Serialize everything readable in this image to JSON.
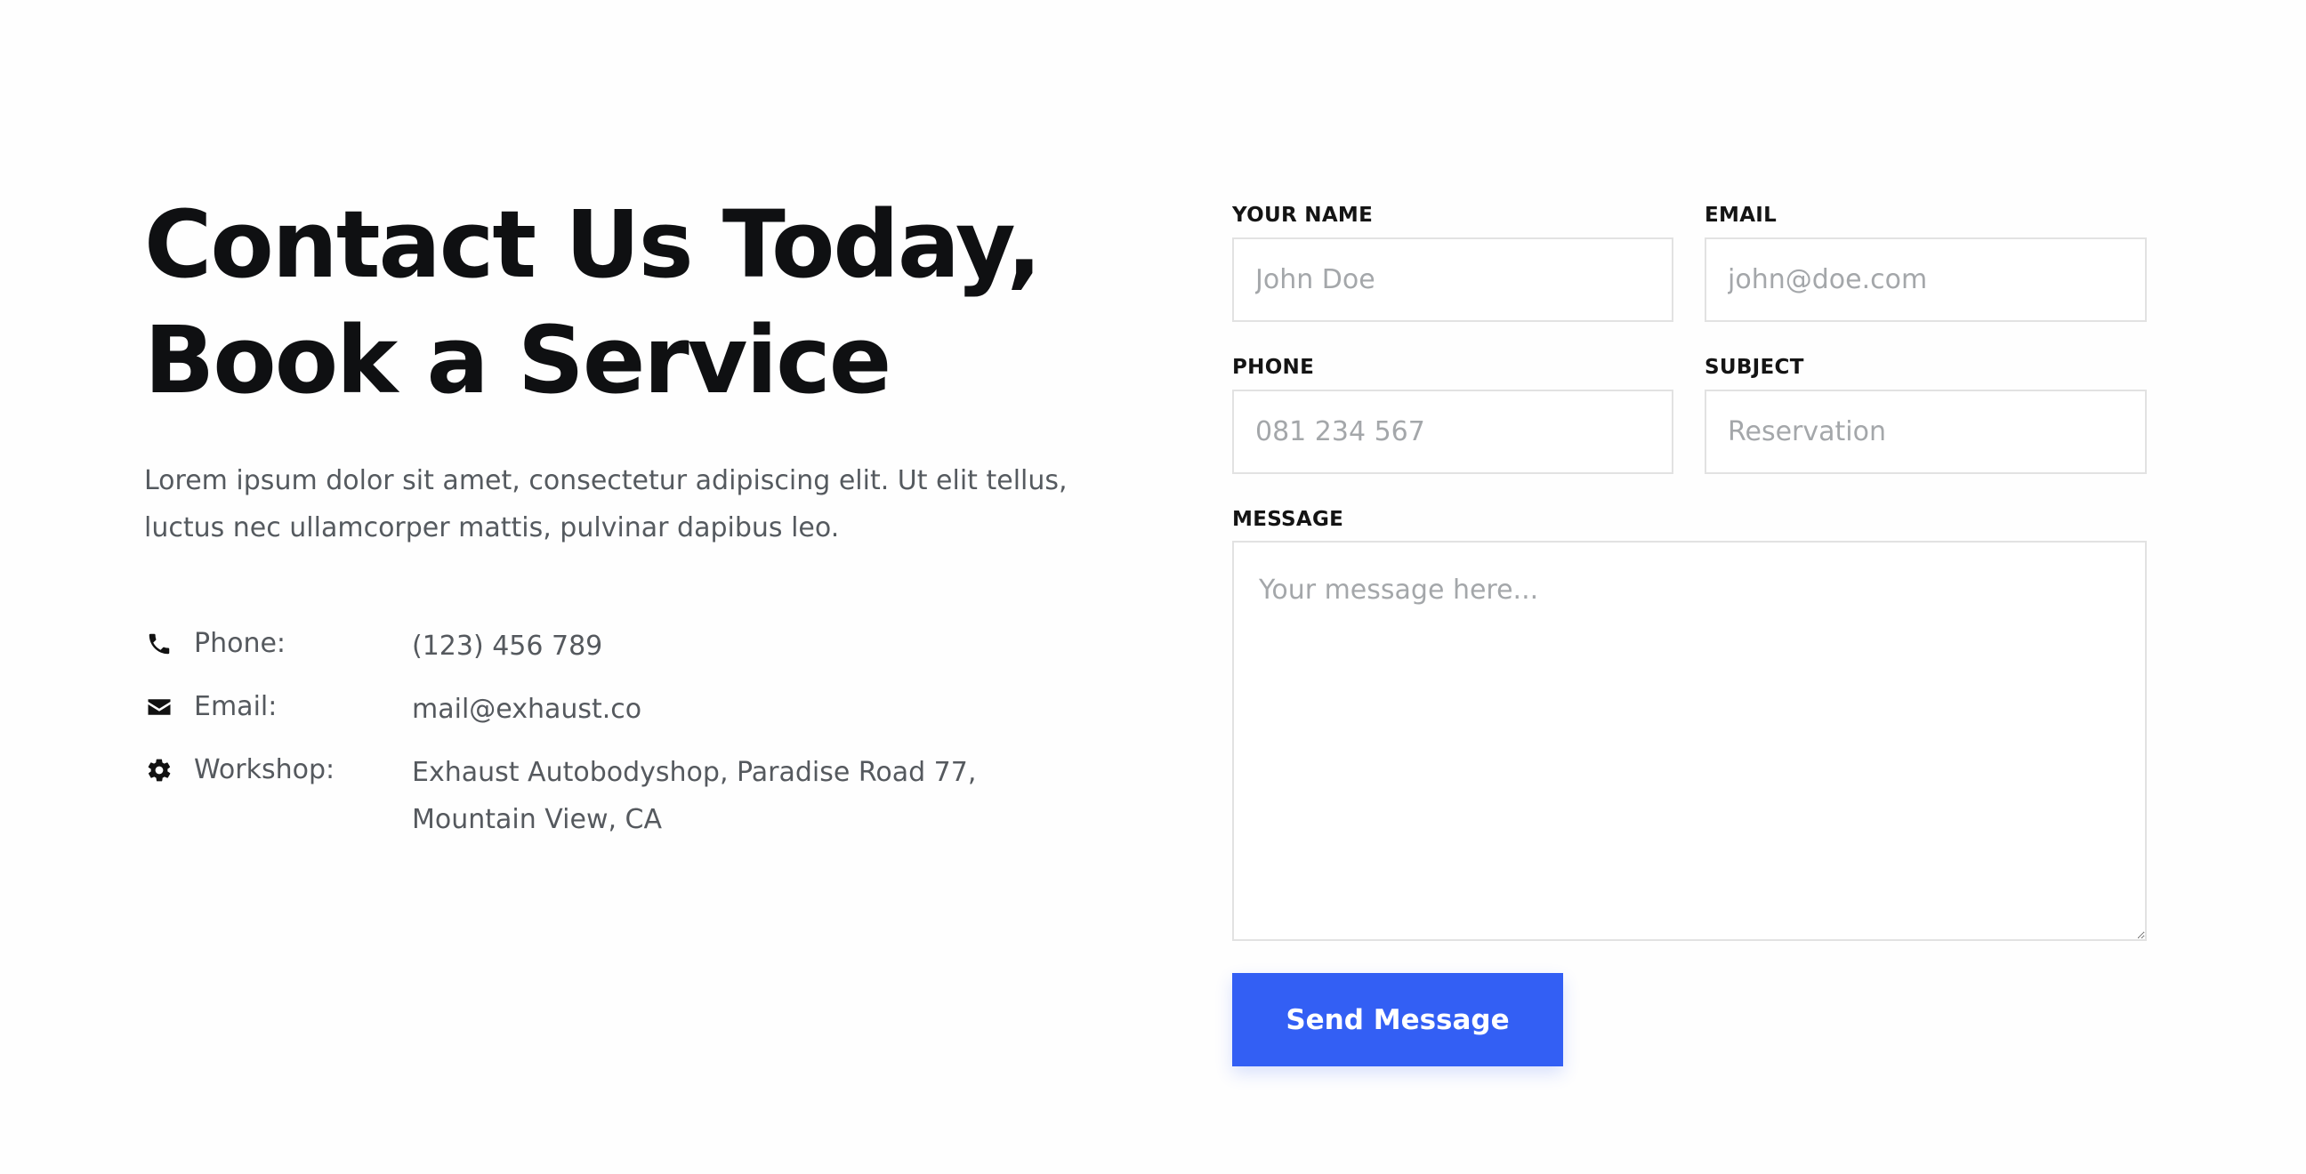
{
  "contact": {
    "headline_line1": "Contact Us Today,",
    "headline_line2": "Book a Service",
    "intro_line1": "Lorem ipsum dolor sit amet, consectetur adipiscing elit. Ut elit tellus,",
    "intro_line2": "luctus nec ullamcorper mattis, pulvinar dapibus leo.",
    "items": [
      {
        "icon": "phone-icon",
        "label": "Phone:",
        "value": "(123) 456 789"
      },
      {
        "icon": "envelope-icon",
        "label": "Email:",
        "value": "mail@exhaust.co"
      },
      {
        "icon": "gear-icon",
        "label": "Workshop:",
        "value_line1": "Exhaust Autobodyshop, Paradise Road 77,",
        "value_line2": "Mountain View, CA"
      }
    ]
  },
  "form": {
    "name_label": "YOUR NAME",
    "name_placeholder": "John Doe",
    "email_label": "EMAIL",
    "email_placeholder": "john@doe.com",
    "phone_label": "PHONE",
    "phone_placeholder": "081 234 567",
    "subject_label": "SUBJECT",
    "subject_placeholder": "Reservation",
    "message_label": "MESSAGE",
    "message_placeholder": "Your message here...",
    "submit_label": "Send Message"
  },
  "colors": {
    "accent": "#335ff4",
    "heading": "#0f1012",
    "body_text": "#55595e",
    "border": "#e2e2e2"
  }
}
